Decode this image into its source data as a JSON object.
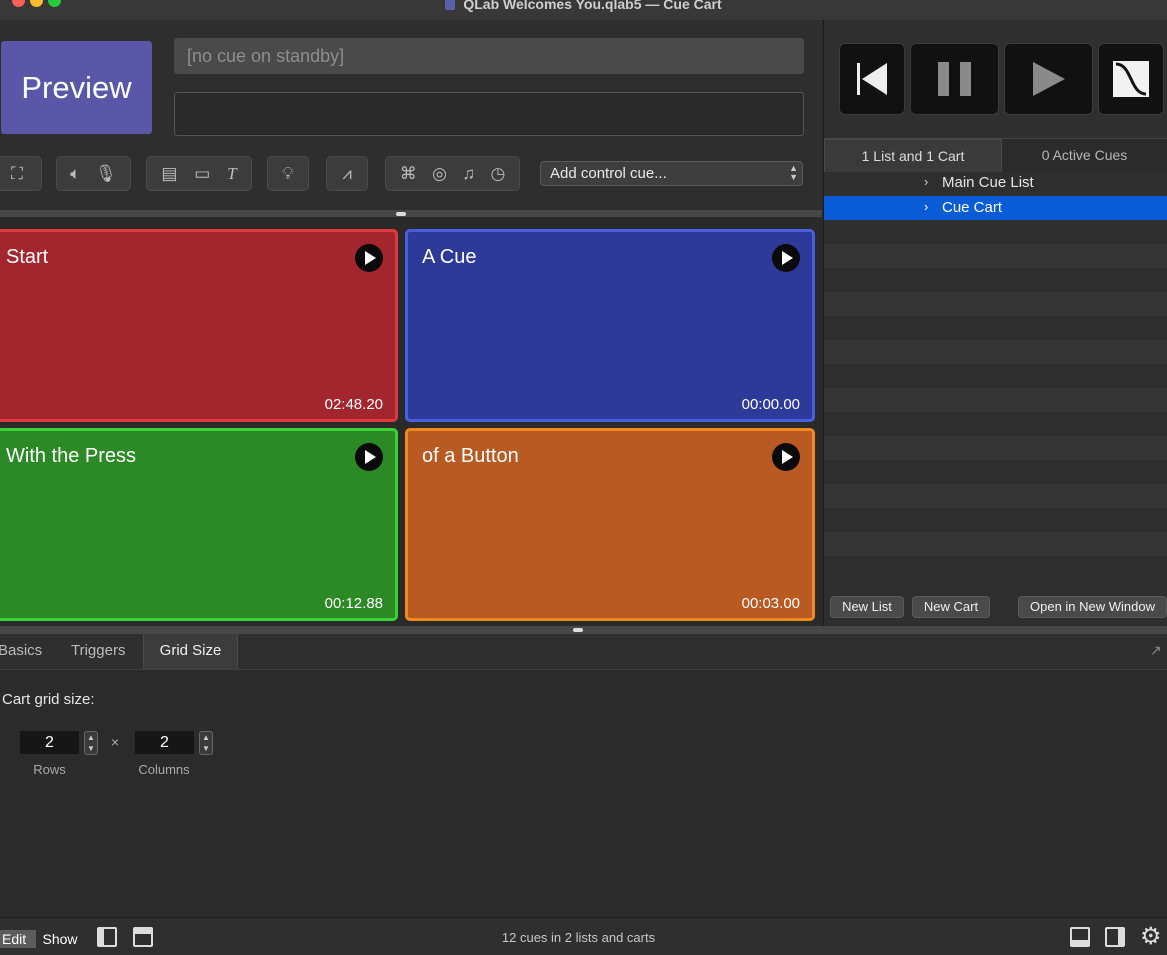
{
  "window": {
    "title": "QLab Welcomes You.qlab5 — Cue Cart"
  },
  "go_button": {
    "label": "Preview",
    "color": "#5a57a8"
  },
  "standby": {
    "placeholder": "[no cue on standby]"
  },
  "toolbar": {
    "add_control_cue": "Add control cue...",
    "icons": [
      "fullscreen-icon",
      "audio-icon",
      "mic-icon",
      "video-icon",
      "camera-icon",
      "text-icon",
      "light-icon",
      "fade-icon",
      "network-icon",
      "midi-icon",
      "music-icon",
      "timecode-icon"
    ]
  },
  "cart": {
    "cues": [
      {
        "name": "Start",
        "time": "02:48.20",
        "color": "#a3262e",
        "border": "#e0393f"
      },
      {
        "name": "A Cue",
        "time": "00:00.00",
        "color": "#2e3a9a",
        "border": "#4a5fe0"
      },
      {
        "name": "With the Press",
        "time": "00:12.88",
        "color": "#2b8a25",
        "border": "#3ad135"
      },
      {
        "name": "of a Button",
        "time": "00:03.00",
        "color": "#b85a22",
        "border": "#f08a1a"
      }
    ]
  },
  "transport": {
    "buttons": [
      "previous-icon",
      "pause-icon",
      "play-icon",
      "fade-curve-icon"
    ]
  },
  "lists_panel": {
    "tabs": [
      "1 List and 1 Cart",
      "0 Active Cues"
    ],
    "items": [
      "Main Cue List",
      "Cue Cart"
    ],
    "selected_color": "#0a5bd6",
    "buttons": [
      "New List",
      "New Cart",
      "Open in New Window"
    ]
  },
  "inspector": {
    "tabs": [
      "Basics",
      "Triggers",
      "Grid Size"
    ],
    "heading": "Cart grid size:",
    "rows": {
      "value": "2",
      "label": "Rows"
    },
    "times": "×",
    "columns": {
      "value": "2",
      "label": "Columns"
    }
  },
  "status": {
    "edit": "Edit",
    "show": "Show",
    "summary": "12 cues in 2 lists and carts"
  }
}
